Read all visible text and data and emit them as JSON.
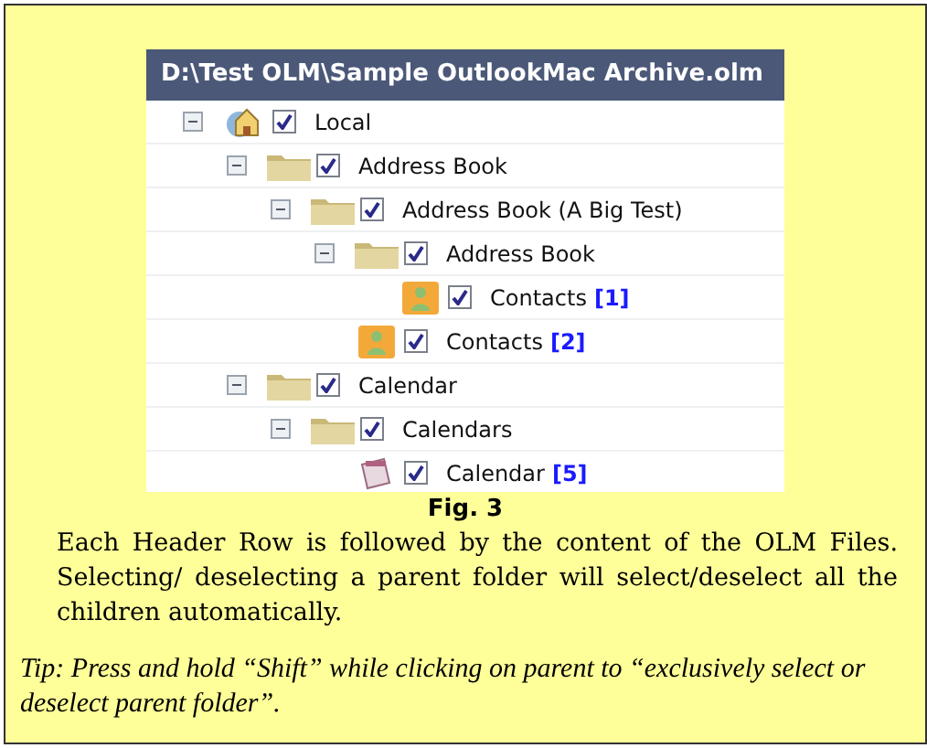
{
  "screenshot": {
    "header": "D:\\Test OLM\\Sample OutlookMac Archive.olm",
    "tree": [
      {
        "kind": "store",
        "label": "Local",
        "checked": true,
        "expanded": true,
        "children": [
          {
            "kind": "folder",
            "label": "Address Book",
            "checked": true,
            "expanded": true,
            "children": [
              {
                "kind": "folder",
                "label": "Address Book (A Big Test)",
                "checked": true,
                "expanded": true,
                "children": [
                  {
                    "kind": "folder",
                    "label": "Address Book",
                    "checked": true,
                    "expanded": true,
                    "children": [
                      {
                        "kind": "contacts",
                        "label": "Contacts",
                        "count": "[1]",
                        "checked": true
                      }
                    ]
                  },
                  {
                    "kind": "contacts",
                    "label": "Contacts",
                    "count": "[2]",
                    "checked": true
                  }
                ]
              }
            ]
          },
          {
            "kind": "folder",
            "label": "Calendar",
            "checked": true,
            "expanded": true,
            "children": [
              {
                "kind": "folder",
                "label": "Calendars",
                "checked": true,
                "expanded": true,
                "children": [
                  {
                    "kind": "calendar",
                    "label": "Calendar",
                    "count": "[5]",
                    "checked": true
                  }
                ]
              }
            ]
          }
        ]
      }
    ]
  },
  "caption": "Fig. 3",
  "description": "Each Header Row is followed by the content of the OLM Files. Selecting/ deselecting a parent folder will select/deselect all the children automatically.",
  "tip": "Tip: Press and hold “Shift” while clicking on parent to  “exclusively select or deselect parent folder”."
}
